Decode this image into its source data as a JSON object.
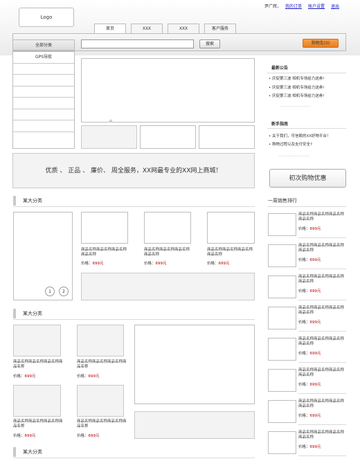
{
  "logo": "Logo",
  "top_links": {
    "greeting": "尹广辉，",
    "orders": "我的订单",
    "account": "帐户设置",
    "logout": "退出"
  },
  "tabs": [
    "首页",
    "XXX",
    "XXX",
    "客户服务"
  ],
  "search": {
    "button": "搜索",
    "placeholder": ""
  },
  "cart": "购物车(0)",
  "categories": {
    "all": "全部分类",
    "items": [
      "GPS导航",
      "",
      "",
      "",
      "",
      "",
      "",
      ""
    ]
  },
  "notice": {
    "title": "最新公告",
    "items": [
      "• 庆促第三波 相机专场给力送券!",
      "• 庆促第三波 相机专场给力送券!",
      "• 庆促第三波 相机专场给力送券!"
    ],
    "more": "………………………"
  },
  "guide": {
    "title": "新手指南",
    "items": [
      "• 关于我们，可信赖的XX好物平台！",
      "• 购物过程以及支付安全?"
    ],
    "more": "………………………"
  },
  "slogan": "优质 、 正品 、 廉价、 周全服务，XX网最专业的XX网上商城！",
  "first_buy": "初次购物优惠",
  "section_title": "某大分类",
  "rank_title": "一周销售排行",
  "product_name": "商品名称商品名称商品名称商品名称",
  "price_label": "价格：",
  "price_value": "699元",
  "pager": [
    "1",
    "2"
  ]
}
